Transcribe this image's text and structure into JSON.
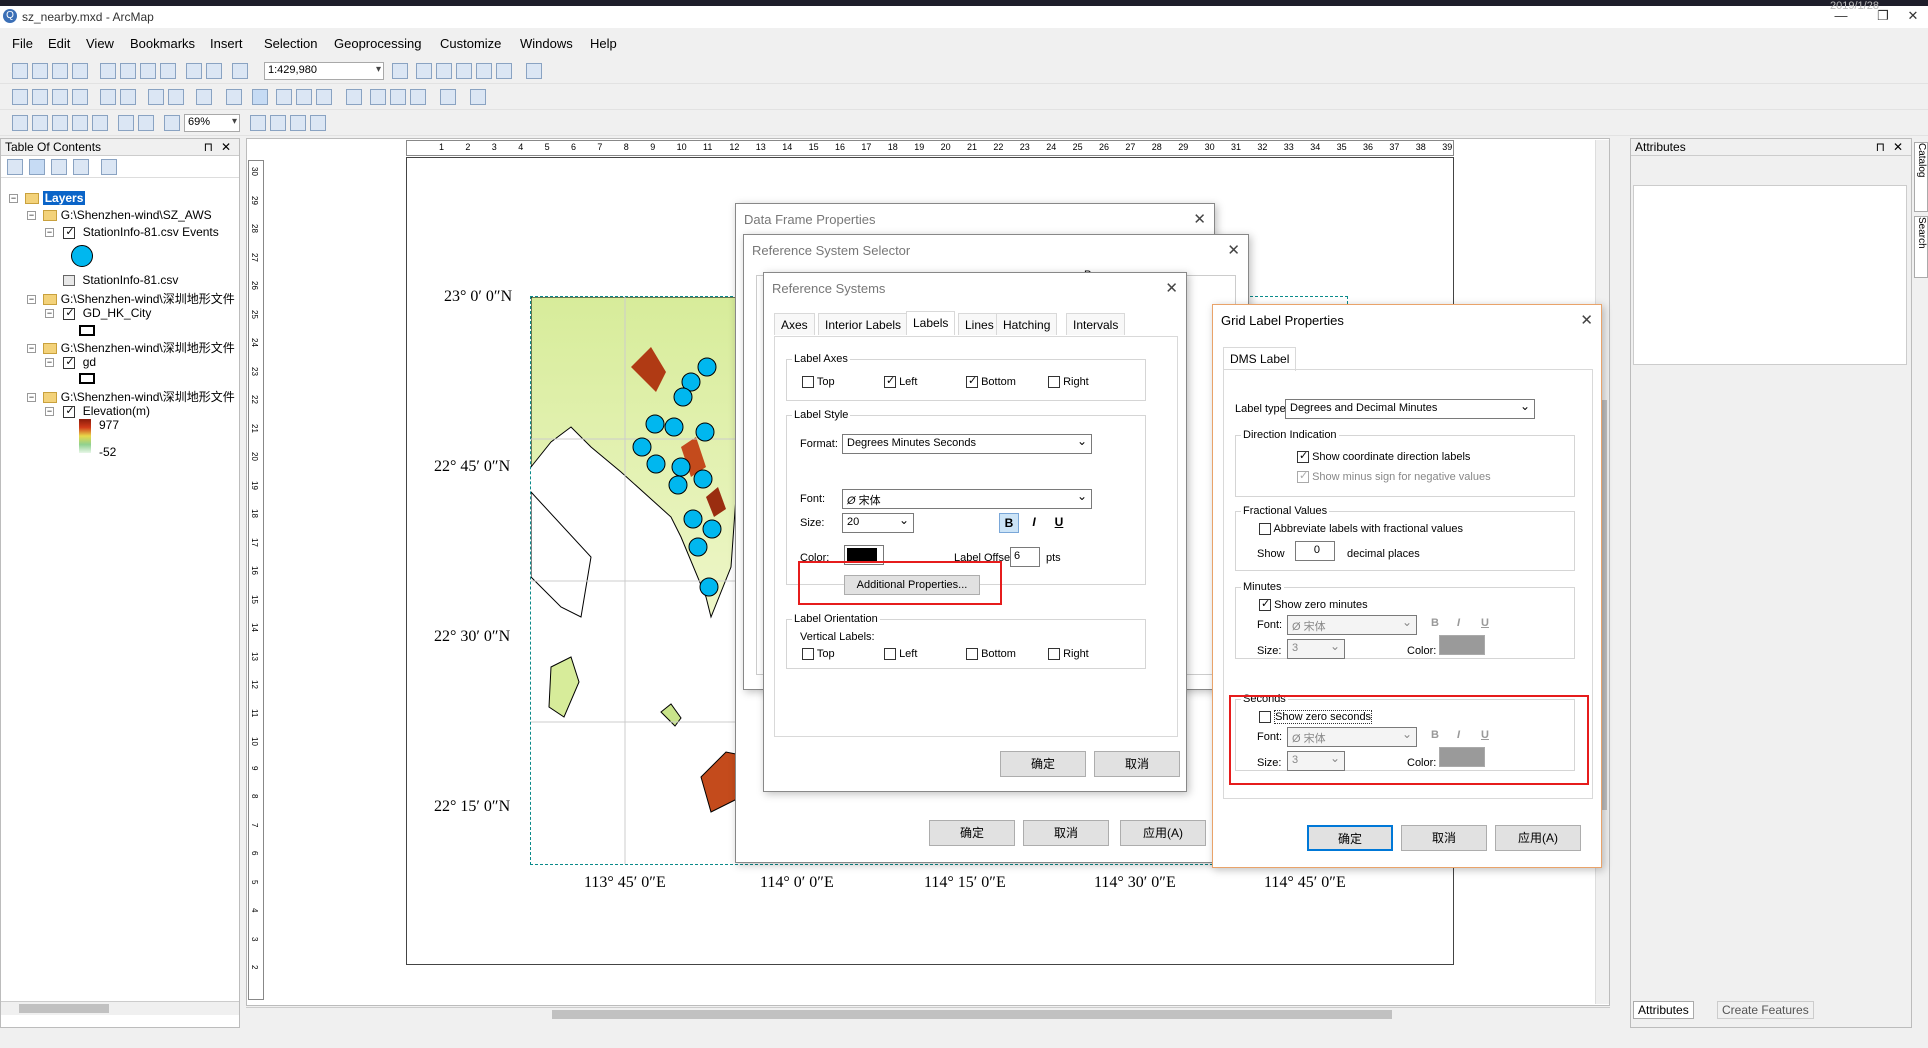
{
  "window": {
    "title": "sz_nearby.mxd - ArcMap",
    "clock": "2019/1/28"
  },
  "menu": [
    "File",
    "Edit",
    "View",
    "Bookmarks",
    "Insert",
    "Selection",
    "Geoprocessing",
    "Customize",
    "Windows",
    "Help"
  ],
  "toolbar": {
    "scale": "1:429,980",
    "zoom": "69%"
  },
  "toc": {
    "title": "Table Of Contents",
    "layers_label": "Layers",
    "groups": [
      {
        "path": "G:\\Shenzhen-wind\\SZ_AWS",
        "layer": "StationInfo-81.csv Events"
      },
      {
        "table": "StationInfo-81.csv"
      },
      {
        "path": "G:\\Shenzhen-wind\\深圳地形文件",
        "layer": "GD_HK_City"
      },
      {
        "path": "G:\\Shenzhen-wind\\深圳地形文件",
        "layer": "gd"
      },
      {
        "path": "G:\\Shenzhen-wind\\深圳地形文件",
        "layer": "Elevation(m)"
      }
    ],
    "legend_high": "977",
    "legend_low": "-52"
  },
  "map": {
    "lat_labels": [
      "23°  0′ 0″N",
      "22°  45′ 0″N",
      "22°  30′ 0″N",
      "22°  15′ 0″N"
    ],
    "lon_labels": [
      "113°  45′ 0″E",
      "114°  0′ 0″E",
      "114°  15′ 0″E",
      "114°  30′ 0″E",
      "114°  45′ 0″E"
    ],
    "ruler_ticks": [
      "1",
      "2",
      "3",
      "4",
      "5",
      "6",
      "7",
      "8",
      "9",
      "10",
      "11",
      "12",
      "13",
      "14",
      "15",
      "16",
      "17",
      "18",
      "19",
      "20",
      "21",
      "22",
      "23",
      "24",
      "25",
      "26",
      "27",
      "28",
      "29",
      "30",
      "31",
      "32",
      "33",
      "34",
      "35",
      "36",
      "37",
      "38",
      "39"
    ],
    "ruler_v_ticks": [
      "30",
      "29",
      "28",
      "27",
      "26",
      "25",
      "24",
      "23",
      "22",
      "21",
      "20",
      "19",
      "18",
      "17",
      "16",
      "15",
      "14",
      "13",
      "12",
      "11",
      "10",
      "9",
      "8",
      "7",
      "6",
      "5",
      "4",
      "3",
      "2"
    ]
  },
  "attributes": {
    "title": "Attributes",
    "tab_attributes": "Attributes",
    "tab_create": "Create Features",
    "side_catalog": "Catalog",
    "side_search": "Search"
  },
  "dlg_dataframe": {
    "title": "Data Frame Properties",
    "ok": "确定",
    "cancel": "取消",
    "apply": "应用(A)"
  },
  "dlg_refsel": {
    "title": "Reference System Selector",
    "partial": "Pr"
  },
  "dlg_refsys": {
    "title": "Reference Systems",
    "tabs": [
      "Axes",
      "Interior Labels",
      "Labels",
      "Lines",
      "Hatching",
      "Intervals"
    ],
    "label_axes": "Label Axes",
    "axes": [
      "Top",
      "Left",
      "Bottom",
      "Right"
    ],
    "label_style": "Label Style",
    "format_label": "Format:",
    "format_value": "Degrees Minutes Seconds",
    "font_label": "Font:",
    "font_value": "宋体",
    "size_label": "Size:",
    "size_value": "20",
    "bold": "B",
    "italic": "I",
    "underline": "U",
    "color_label": "Color:",
    "offset_label": "Label Offset:",
    "offset_value": "6",
    "offset_unit": "pts",
    "additional": "Additional Properties...",
    "orientation": "Label Orientation",
    "vertical": "Vertical Labels:",
    "ok": "确定",
    "cancel": "取消"
  },
  "dlg_grid": {
    "title": "Grid Label Properties",
    "tab": "DMS Label",
    "label_type_lbl": "Label type:",
    "label_type": "Degrees and Decimal Minutes",
    "direction": "Direction Indication",
    "show_dir": "Show coordinate direction labels",
    "show_minus": "Show minus sign for negative values",
    "fractional": "Fractional Values",
    "abbrev": "Abbreviate labels with fractional values",
    "show": "Show",
    "decimal_value": "0",
    "decimal_places": "decimal places",
    "minutes": "Minutes",
    "show_zero_min": "Show zero minutes",
    "seconds": "Seconds",
    "show_zero_sec": "Show zero seconds",
    "font_lbl": "Font:",
    "font": "宋体",
    "size_lbl": "Size:",
    "size": "3",
    "color_lbl": "Color:",
    "b": "B",
    "i": "I",
    "u": "U",
    "ok": "确定",
    "cancel": "取消",
    "apply": "应用(A)"
  },
  "colors": {
    "accent": "#0078d7",
    "highlight_red": "#e61c1c",
    "station_fill": "#00b7ef"
  }
}
